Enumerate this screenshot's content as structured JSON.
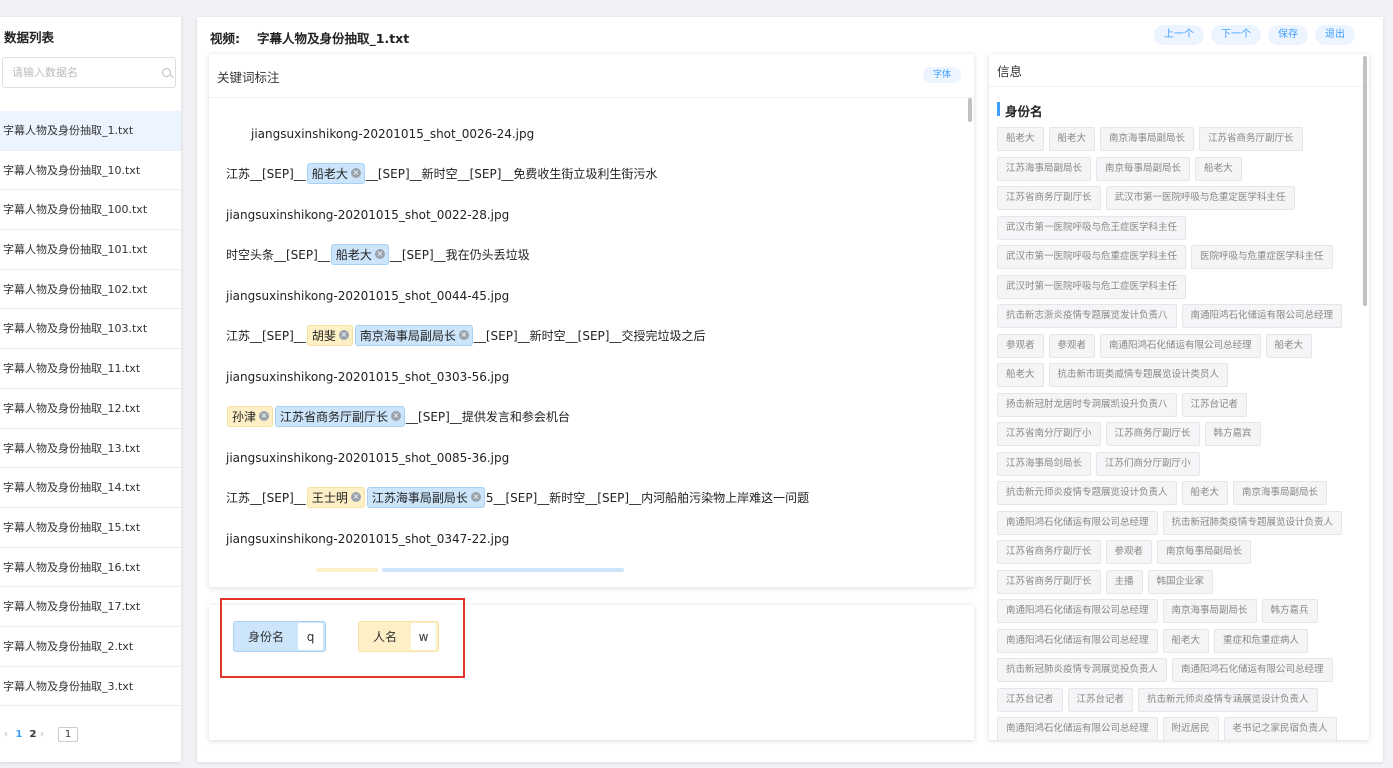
{
  "sidebar": {
    "title": "数据列表",
    "search_placeholder": "请输入数据名",
    "items": [
      {
        "label": "字幕人物及身份抽取_1.txt"
      },
      {
        "label": "字幕人物及身份抽取_10.txt"
      },
      {
        "label": "字幕人物及身份抽取_100.txt"
      },
      {
        "label": "字幕人物及身份抽取_101.txt"
      },
      {
        "label": "字幕人物及身份抽取_102.txt"
      },
      {
        "label": "字幕人物及身份抽取_103.txt"
      },
      {
        "label": "字幕人物及身份抽取_11.txt"
      },
      {
        "label": "字幕人物及身份抽取_12.txt"
      },
      {
        "label": "字幕人物及身份抽取_13.txt"
      },
      {
        "label": "字幕人物及身份抽取_14.txt"
      },
      {
        "label": "字幕人物及身份抽取_15.txt"
      },
      {
        "label": "字幕人物及身份抽取_16.txt"
      },
      {
        "label": "字幕人物及身份抽取_17.txt"
      },
      {
        "label": "字幕人物及身份抽取_2.txt"
      },
      {
        "label": "字幕人物及身份抽取_3.txt"
      }
    ],
    "pager": {
      "prev": "‹",
      "next": "›",
      "page1": "1",
      "page2": "2",
      "jump": "1"
    }
  },
  "header": {
    "label": "视频:",
    "file": "字幕人物及身份抽取_1.txt",
    "buttons": {
      "prev": "上一个",
      "next": "下一个",
      "save": "保存",
      "exit": "退出"
    }
  },
  "keyword": {
    "title": "关键词标注",
    "font_button": "字体",
    "lines": [
      {
        "t1": "jiangsuxinshikong-20201015_shot_0026-24.jpg"
      },
      {
        "pre": "江苏__[SEP]__",
        "tag": "船老大",
        "post": "__[SEP]__新时空__[SEP]__免费收生街立圾利生街污水"
      },
      {
        "t1": "jiangsuxinshikong-20201015_shot_0022-28.jpg"
      },
      {
        "pre": "时空头条__[SEP]__",
        "tag": "船老大",
        "post": "__[SEP]__我在仍头丢垃圾"
      },
      {
        "t1": "jiangsuxinshikong-20201015_shot_0044-45.jpg"
      },
      {
        "pre": "江苏__[SEP]__",
        "person": "胡斐",
        "tag": "南京海事局副局长",
        "post": "__[SEP]__新时空__[SEP]__交授完垃圾之后"
      },
      {
        "t1": "jiangsuxinshikong-20201015_shot_0303-56.jpg"
      },
      {
        "person": "孙津",
        "tag": "江苏省商务厅副厅长",
        "post": "__[SEP]__提供发言和参会机台"
      },
      {
        "t1": "jiangsuxinshikong-20201015_shot_0085-36.jpg"
      },
      {
        "pre": "江苏__[SEP]__",
        "person": "王士明",
        "tag": "江苏海事局副局长",
        "post": "5__[SEP]__新时空__[SEP]__内河船舶污染物上岸难这一问题"
      },
      {
        "t1": "jiangsuxinshikong-20201015_shot_0347-22.jpg"
      }
    ]
  },
  "labels": {
    "role": {
      "name": "身份名",
      "key": "q"
    },
    "person": {
      "name": "人名",
      "key": "w"
    }
  },
  "info": {
    "title": "信息",
    "section": "身份名",
    "chips": [
      "船老大",
      "船老大",
      "南京海事局副局长",
      "江苏省商务厅副厅长",
      "江苏海事局副局长",
      "南京每事局副局长",
      "船老大",
      "江苏省商务厅副厅长",
      "武汉市第一医院呼吸与危重定医学科主任",
      "武汉市第一医院呼吸与危王症医学科主任",
      "武汉市第一医院呼吸与危重症医学科主任",
      "医院呼吸与危重症医学科主任",
      "武汉时第一医院呼吸与危工症医学科主任",
      "抗击新志浙炎疫情专题展览发计负责八",
      "南通阳鸿石化储运有限公司总经理",
      "参观者",
      "参观者",
      "南通阳鸿石化储运有限公司总经理",
      "船老大",
      "船老大",
      "抗击新市斑类威情专题展览设计类员人",
      "扬击新冠肘龙居时专洞展凯设升负责八",
      "江苏台记者",
      "江苏省南分厅副厅小",
      "江苏商务厅副厅长",
      "韩方嘉宾",
      "江苏海事局剑局长",
      "江苏们商分厅副厅小",
      "抗击新元师炎疫情专题展览设计负责人",
      "船老大",
      "南京海事局副局长",
      "南通阳鸿石化储运有限公司总经理",
      "抗击新冠肺类疫情专题展览设计负责人",
      "江苏省商务疗副厅长",
      "参观者",
      "南京每事局副局长",
      "江苏省商务厅副厅长",
      "主播",
      "韩国企业家",
      "南通阳鸿石化储运有限公司总经理",
      "南京海事局副局长",
      "韩方嘉兵",
      "南通阳鸿石化储运有限公司总经理",
      "船老大",
      "重症和危重症病人",
      "抗击新冠肺炎疫情专洞展览投负责人",
      "南通阳鸿石化储运有限公司总经理",
      "江苏台记者",
      "江苏台记者",
      "抗击新元师炎疫情专涵展览设计负责人",
      "南通阳鸿石化储运有限公司总经理",
      "附近居民",
      "老书记之家民宿负责人"
    ]
  },
  "colors": {
    "accent": "#409eff",
    "role_bg": "#cce5fb",
    "person_bg": "#fdf0c6",
    "highlight_box": "#e2342d"
  }
}
